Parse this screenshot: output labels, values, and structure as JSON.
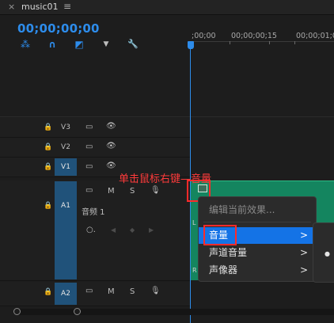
{
  "tab": {
    "close_glyph": "×",
    "title": "music01",
    "menu_glyph": "≡"
  },
  "header": {
    "timecode": "00;00;00;00",
    "tools": [
      {
        "name": "insert-sequence-icon",
        "glyph": "⁂"
      },
      {
        "name": "snap-magnet-icon",
        "glyph": "∩"
      },
      {
        "name": "linked-selection-icon",
        "glyph": "◩"
      },
      {
        "name": "add-marker-icon",
        "glyph": "▼"
      },
      {
        "name": "timeline-settings-wrench-icon",
        "glyph": "🔧"
      }
    ]
  },
  "ruler": {
    "labels": [
      ";00;00",
      "00;00;00;15",
      "00;00;01;0"
    ]
  },
  "tracks": {
    "video": [
      {
        "label": "V3",
        "selected": false
      },
      {
        "label": "V2",
        "selected": false
      },
      {
        "label": "V1",
        "selected": true
      }
    ],
    "audio": [
      {
        "label": "A1",
        "name": "音频 1",
        "mute": "M",
        "solo": "S",
        "selected": true
      },
      {
        "label": "A2",
        "mute": "M",
        "solo": "S",
        "selected": true
      }
    ]
  },
  "annotation": {
    "text": "单击鼠标右键—音量"
  },
  "context_menu": {
    "items": [
      {
        "label": "编辑当前效果...",
        "state": "disabled",
        "submenu": false
      },
      {
        "label": "音量",
        "state": "highlighted",
        "submenu": true
      },
      {
        "label": "声道音量",
        "state": "normal",
        "submenu": true
      },
      {
        "label": "声像器",
        "state": "normal",
        "submenu": true
      }
    ],
    "arrow_glyph": ">"
  },
  "clip": {
    "edge_labels": [
      "L",
      "R"
    ]
  },
  "submenu": {
    "bullet": "●"
  },
  "colors": {
    "accent": "#2d8ceb",
    "clip": "#14855f",
    "highlight": "#1473e6",
    "annotation": "#ff2a2a"
  }
}
